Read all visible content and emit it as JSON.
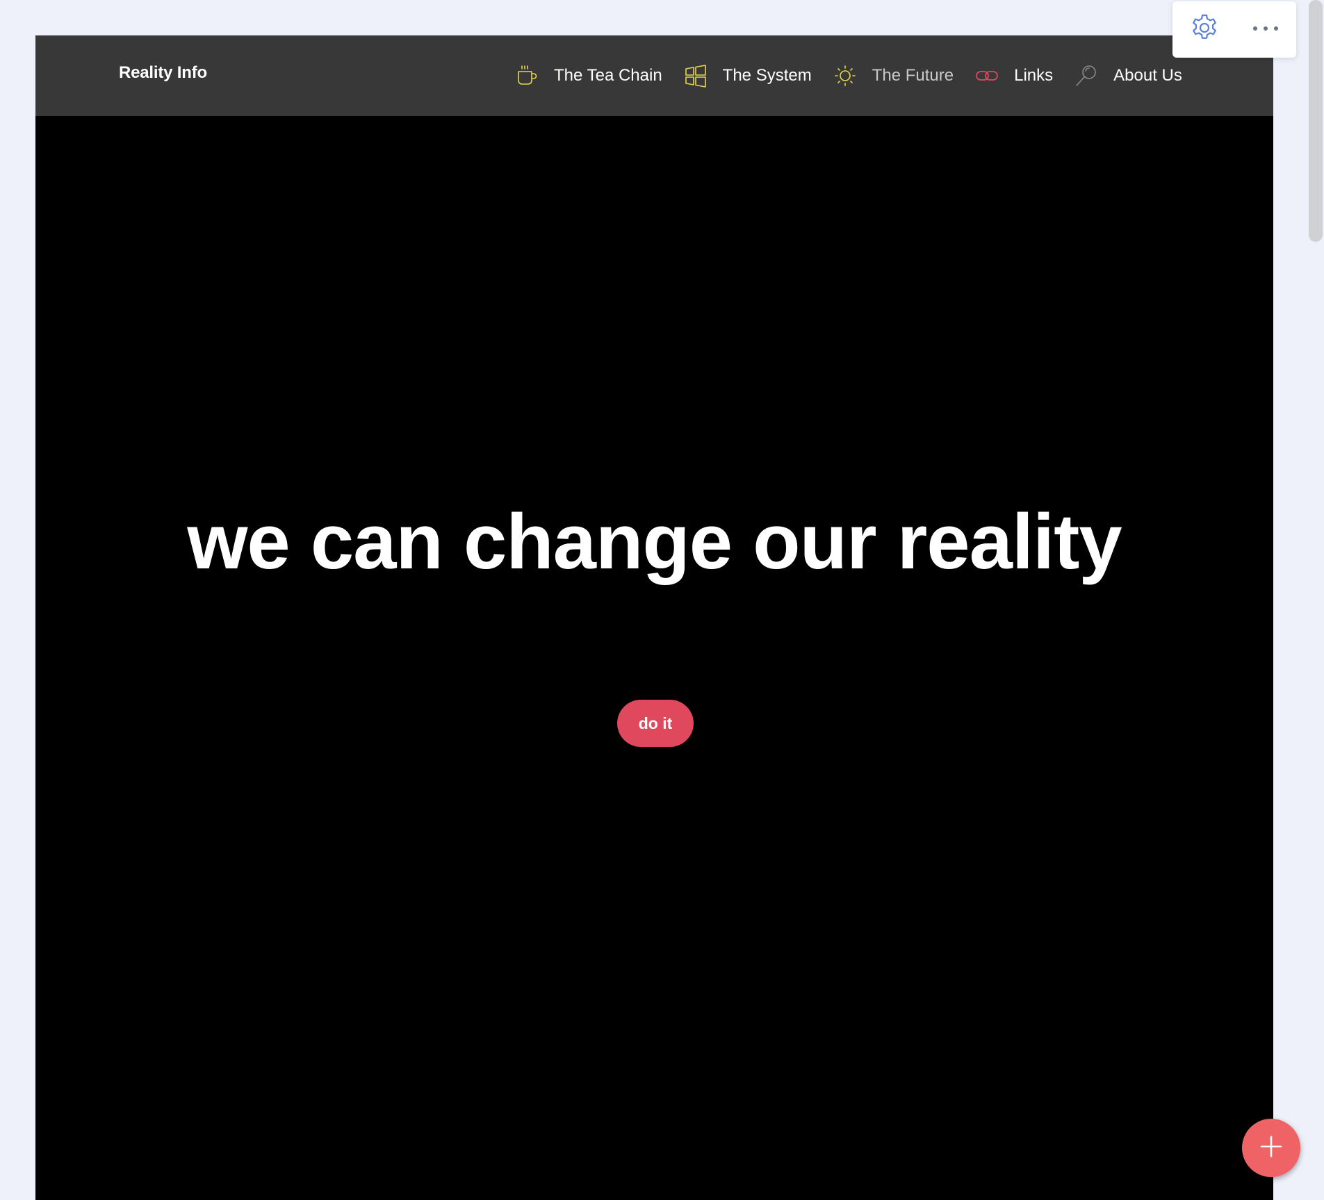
{
  "brand": {
    "title": "Reality Info"
  },
  "nav": {
    "items": [
      {
        "label": "The Tea Chain",
        "icon": "cup-icon",
        "icon_color": "#e6d84a"
      },
      {
        "label": "The System",
        "icon": "windows-icon",
        "icon_color": "#e6d84a"
      },
      {
        "label": "The Future",
        "icon": "sun-icon",
        "icon_color": "#e6d84a"
      },
      {
        "label": "Links",
        "icon": "link-icon",
        "icon_color": "#e0485e"
      },
      {
        "label": "About Us",
        "icon": "magnifier-icon",
        "icon_color": "#8a8a8a"
      }
    ]
  },
  "hero": {
    "headline": "we can change our reality",
    "cta_label": "do it",
    "cta_color": "#e0485e"
  },
  "toolbar": {
    "settings_icon": "gear-icon",
    "more_icon": "more-horizontal-icon",
    "accent": "#5b7fd6"
  },
  "fab": {
    "icon": "plus-icon",
    "color": "#ef6366"
  }
}
